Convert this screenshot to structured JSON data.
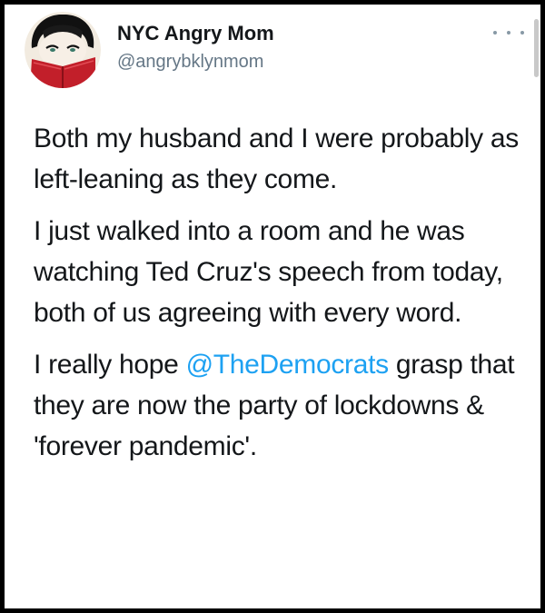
{
  "author": {
    "display_name": "NYC Angry Mom",
    "handle": "@angrybklynmom",
    "avatar_icon": "avatar-woman-reading-icon"
  },
  "menu": {
    "icon": "more-options-icon"
  },
  "tweet": {
    "para1": "Both my husband and I were probably as left-leaning as they come.",
    "para2": "I just walked into a room and he was watching Ted Cruz's speech from today, both of us agreeing with every word.",
    "para3_before": "I really hope ",
    "para3_mention": "@TheDemocrats",
    "para3_after": " grasp that they are now the party of lockdowns & 'forever pandemic'."
  },
  "colors": {
    "text": "#14171a",
    "secondary": "#657786",
    "mention": "#1da1f2",
    "frame": "#000000"
  }
}
